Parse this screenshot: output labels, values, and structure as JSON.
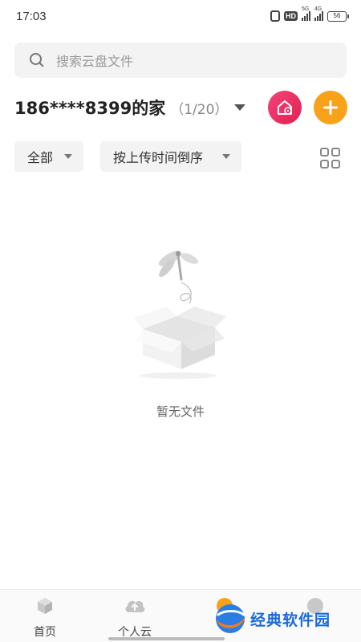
{
  "status_bar": {
    "time": "17:03",
    "hd_label": "HD",
    "signal_1_label": "5G",
    "signal_2_label": "4G",
    "battery": "56"
  },
  "search": {
    "placeholder": "搜索云盘文件"
  },
  "family": {
    "name": "186****8399的家",
    "count": "（1/20）"
  },
  "filters": {
    "type_label": "全部",
    "sort_label": "按上传时间倒序"
  },
  "empty_state": {
    "message": "暂无文件"
  },
  "bottom_nav": {
    "items": [
      {
        "label": "首页",
        "icon": "cube-icon"
      },
      {
        "label": "个人云",
        "icon": "cloud-upload-icon"
      },
      {
        "label": "",
        "icon": "family-cloud-icon"
      },
      {
        "label": "",
        "icon": "profile-icon"
      }
    ]
  },
  "watermark": {
    "text": "经典软件园"
  },
  "colors": {
    "home_button": "#e8306a",
    "add_button": "#f8a21a",
    "search_bg": "#f3f3f3",
    "watermark_text": "#1a6ad8"
  }
}
